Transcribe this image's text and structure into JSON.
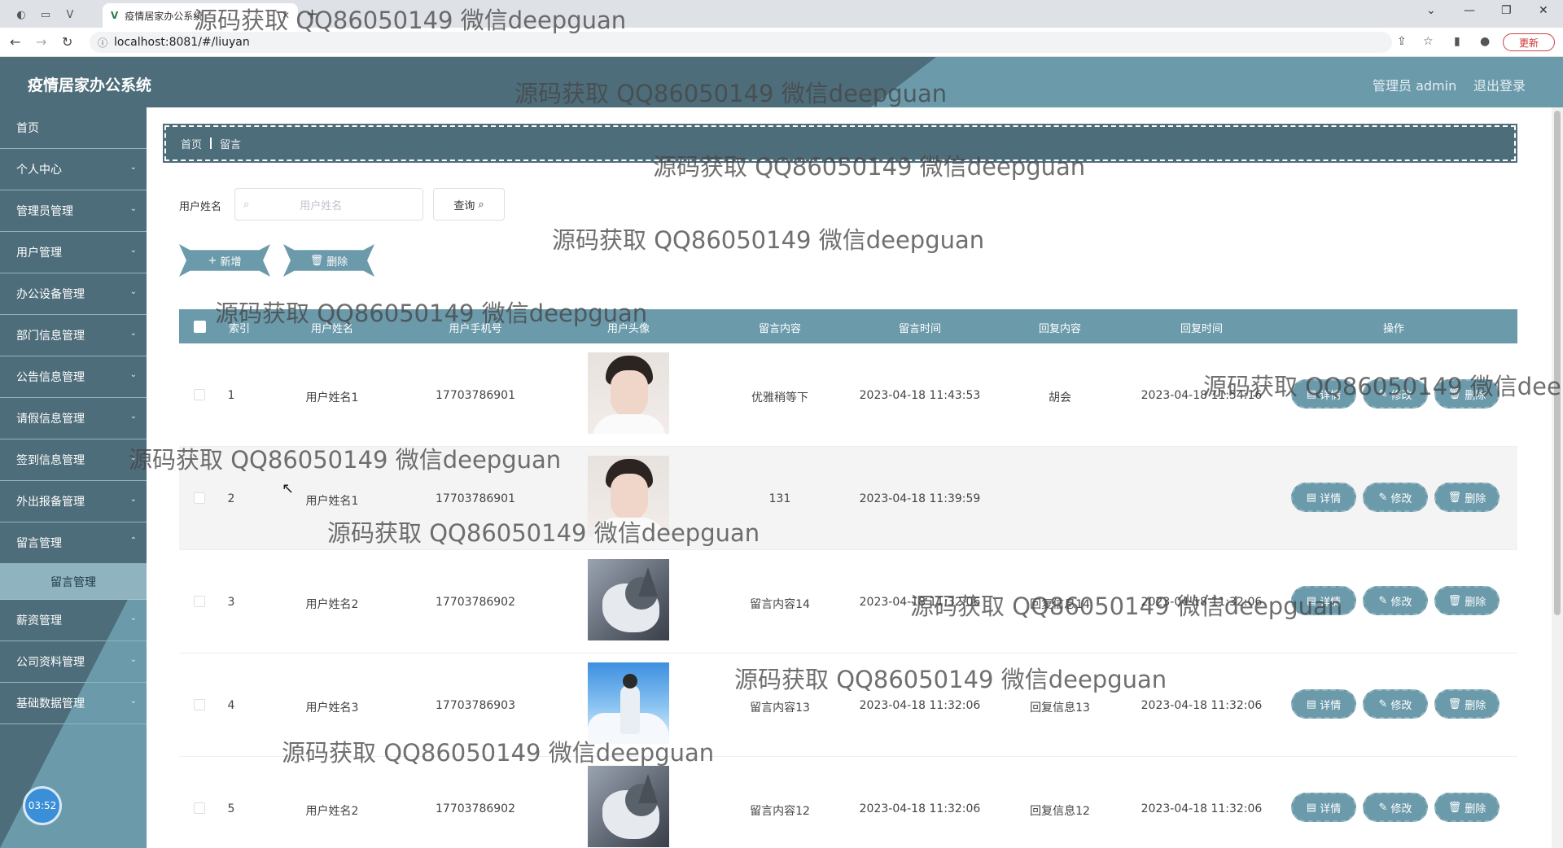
{
  "browser": {
    "tab_title": "疫情居家办公系统",
    "url": "localhost:8081/#/liuyan",
    "update_label": "更新"
  },
  "header": {
    "app_title": "疫情居家办公系统",
    "admin_label": "管理员 admin",
    "logout_label": "退出登录"
  },
  "sidebar": {
    "items": [
      {
        "label": "首页"
      },
      {
        "label": "个人中心"
      },
      {
        "label": "管理员管理"
      },
      {
        "label": "用户管理"
      },
      {
        "label": "办公设备管理"
      },
      {
        "label": "部门信息管理"
      },
      {
        "label": "公告信息管理"
      },
      {
        "label": "请假信息管理"
      },
      {
        "label": "签到信息管理"
      },
      {
        "label": "外出报备管理"
      },
      {
        "label": "留言管理"
      }
    ],
    "active_sub": "留言管理",
    "items_after": [
      {
        "label": "薪资管理"
      },
      {
        "label": "公司资料管理"
      },
      {
        "label": "基础数据管理"
      }
    ],
    "clock": "03:52"
  },
  "breadcrumb": {
    "home": "首页",
    "current": "留言"
  },
  "search": {
    "label": "用户姓名",
    "placeholder": "用户姓名",
    "button_label": "查询"
  },
  "actions": {
    "add_label": "新增",
    "delete_label": "删除"
  },
  "table": {
    "columns": [
      "索引",
      "用户姓名",
      "用户手机号",
      "用户头像",
      "留言内容",
      "留言时间",
      "回复内容",
      "回复时间",
      "操作"
    ],
    "rows": [
      {
        "index": "1",
        "name": "用户姓名1",
        "phone": "17703786901",
        "avatar": "boy",
        "content": "优雅稍等下",
        "time": "2023-04-18 11:43:53",
        "reply": "胡会",
        "reply_time": "2023-04-18 11:54:16"
      },
      {
        "index": "2",
        "name": "用户姓名1",
        "phone": "17703786901",
        "avatar": "boy",
        "content": "131",
        "time": "2023-04-18 11:39:59",
        "reply": "",
        "reply_time": ""
      },
      {
        "index": "3",
        "name": "用户姓名2",
        "phone": "17703786902",
        "avatar": "dog",
        "content": "留言内容14",
        "time": "2023-04-18 11:32:06",
        "reply": "回复信息14",
        "reply_time": "2023-04-18 11:32:06"
      },
      {
        "index": "4",
        "name": "用户姓名3",
        "phone": "17703786903",
        "avatar": "sky",
        "content": "留言内容13",
        "time": "2023-04-18 11:32:06",
        "reply": "回复信息13",
        "reply_time": "2023-04-18 11:32:06"
      },
      {
        "index": "5",
        "name": "用户姓名2",
        "phone": "17703786902",
        "avatar": "dog",
        "content": "留言内容12",
        "time": "2023-04-18 11:32:06",
        "reply": "回复信息12",
        "reply_time": "2023-04-18 11:32:06"
      }
    ],
    "op_labels": {
      "detail": "详情",
      "edit": "修改",
      "delete": "删除"
    }
  },
  "watermark_text": "源码获取 QQ86050149 微信deepguan",
  "icons": {
    "search": "search-icon",
    "add": "plus-icon",
    "delete": "trash-icon",
    "edit": "pencil-icon",
    "detail": "document-icon"
  },
  "colors": {
    "primary": "#6b9aab",
    "dark": "#4e6d7a",
    "accent": "#8fb3bf"
  }
}
